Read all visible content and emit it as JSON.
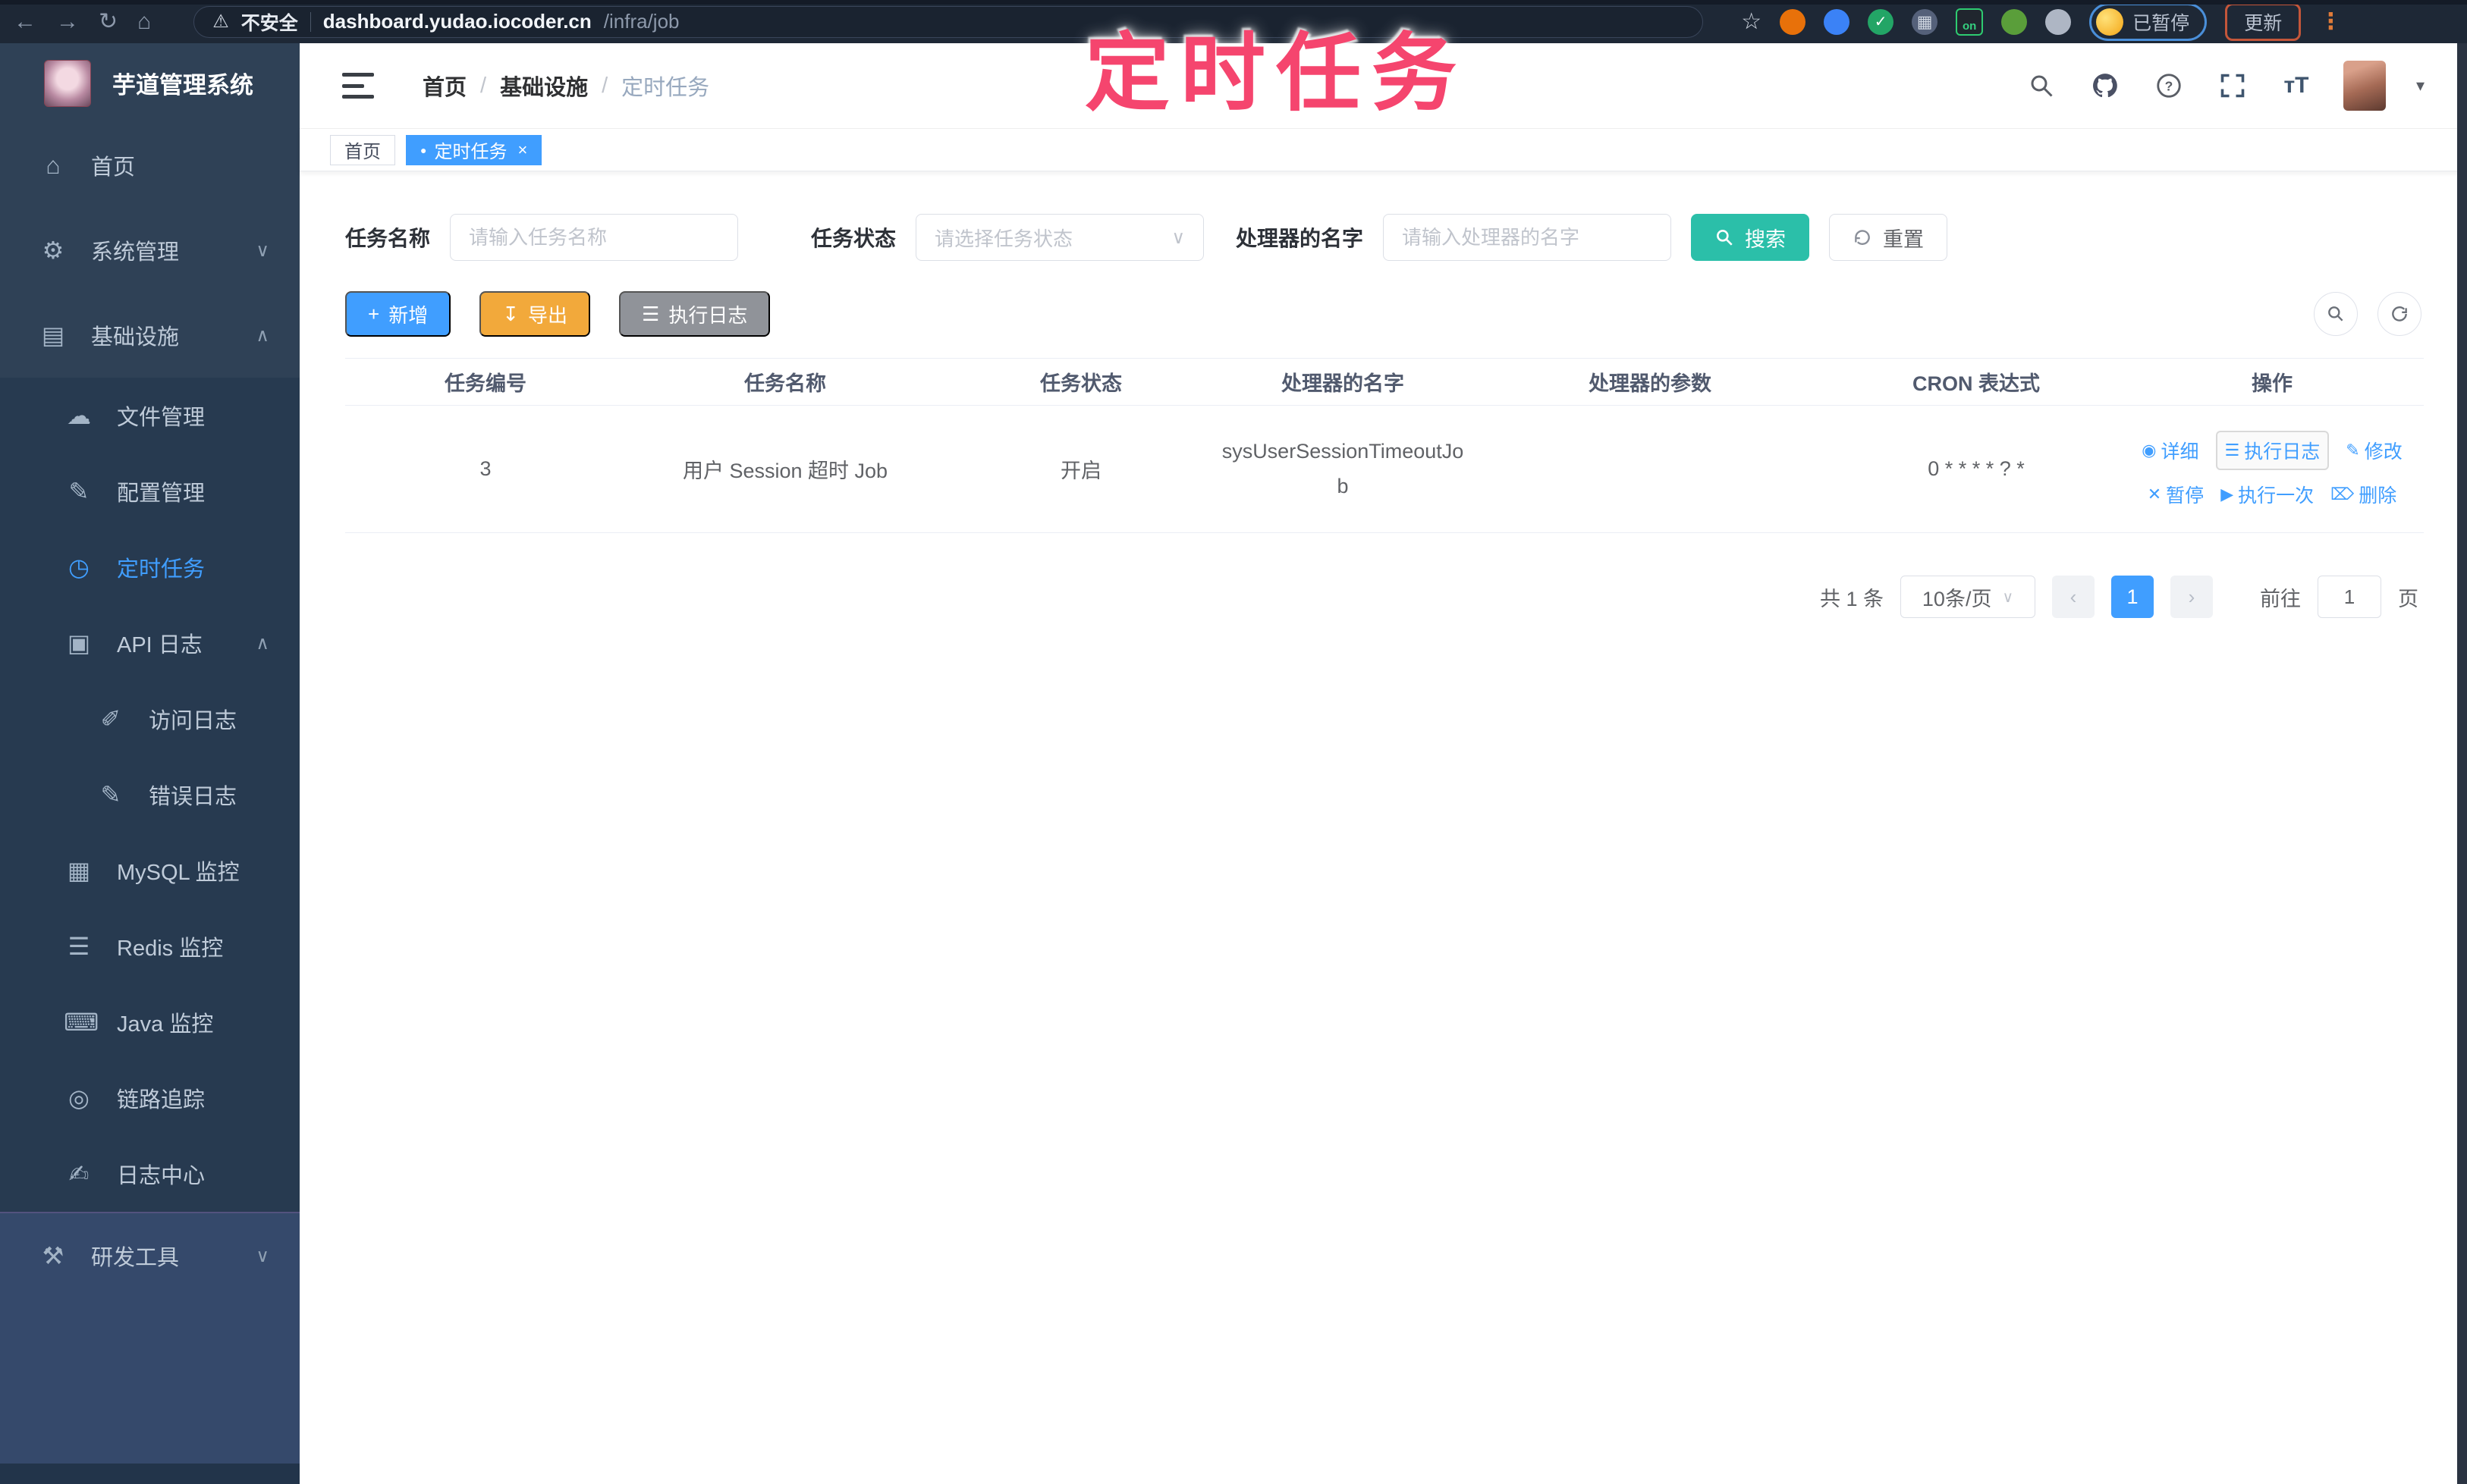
{
  "browser": {
    "back": "←",
    "forward": "→",
    "reload": "↻",
    "home": "⌂",
    "warning_icon": "⚠",
    "security_label": "不安全",
    "url_domain": "dashboard.yudao.iocoder.cn",
    "url_path": "/infra/job",
    "star_icon": "☆",
    "ext_on_label": "on",
    "ext_check": "✓",
    "ext_grid": "▦",
    "paused_label": "已暂停",
    "update_label": "更新",
    "kebab_icon": "⋮"
  },
  "annotation": {
    "text": "定时任务"
  },
  "sidebar": {
    "title": "芋道管理系统",
    "items": [
      {
        "label": "首页"
      },
      {
        "label": "系统管理"
      },
      {
        "label": "基础设施"
      },
      {
        "label": "文件管理"
      },
      {
        "label": "配置管理"
      },
      {
        "label": "定时任务"
      },
      {
        "label": "API 日志"
      },
      {
        "label": "访问日志"
      },
      {
        "label": "错误日志"
      },
      {
        "label": "MySQL 监控"
      },
      {
        "label": "Redis 监控"
      },
      {
        "label": "Java 监控"
      },
      {
        "label": "链路追踪"
      },
      {
        "label": "日志中心"
      },
      {
        "label": "研发工具"
      }
    ]
  },
  "icons": {
    "home": "⌂",
    "gear": "⚙",
    "infra": "▤",
    "file": "☁",
    "config": "✎",
    "job": "◷",
    "apilog": "▣",
    "accesslog": "✐",
    "errorlog": "✎",
    "mysql": "▦",
    "redis": "☰",
    "java": "⌨",
    "trace": "◎",
    "logcenter": "✍",
    "devtools": "⚒",
    "chevron_down": "∨",
    "chevron_up": "∧",
    "plus": "+",
    "export": "↧",
    "list": "☰",
    "detail": "◉",
    "edit": "✎",
    "pause": "✕",
    "run": "▶",
    "delete": "⌦",
    "caret_down": "▾"
  },
  "header": {
    "breadcrumb": {
      "0": "首页",
      "1": "基础设施",
      "2": "定时任务"
    },
    "separator": "/"
  },
  "tabs": {
    "0": {
      "label": "首页"
    },
    "1": {
      "label": "定时任务",
      "dot": "●",
      "close": "×"
    }
  },
  "filters": {
    "name_label": "任务名称",
    "name_placeholder": "请输入任务名称",
    "status_label": "任务状态",
    "status_placeholder": "请选择任务状态",
    "handler_label": "处理器的名字",
    "handler_placeholder": "请输入处理器的名字",
    "search_label": "搜索",
    "reset_label": "重置"
  },
  "toolbar": {
    "add_label": "新增",
    "export_label": "导出",
    "job_log_label": "执行日志"
  },
  "table": {
    "columns": {
      "0": "任务编号",
      "1": "任务名称",
      "2": "任务状态",
      "3": "处理器的名字",
      "4": "处理器的参数",
      "5": "CRON 表达式",
      "6": "操作"
    },
    "row": {
      "id": "3",
      "name": "用户 Session 超时 Job",
      "status": "开启",
      "handler": "sysUserSessionTimeoutJob",
      "param": "",
      "cron": "0 * * * * ? *",
      "actions": {
        "0": "详细",
        "1": "执行日志",
        "2": "修改",
        "3": "暂停",
        "4": "执行一次",
        "5": "删除"
      }
    }
  },
  "pagination": {
    "total": "共 1 条",
    "page_size": "10条/页",
    "prev": "‹",
    "next": "›",
    "page": "1",
    "goto_label": "前往",
    "goto_value": "1",
    "page_suffix": "页"
  },
  "colors": {
    "accent_blue": "#409EFF",
    "search_teal": "#2BBFA9",
    "export_orange": "#F2A93B",
    "info_gray": "#909399",
    "sidebar_bg": "#2F4156",
    "annotation_pink": "#F5456E"
  }
}
